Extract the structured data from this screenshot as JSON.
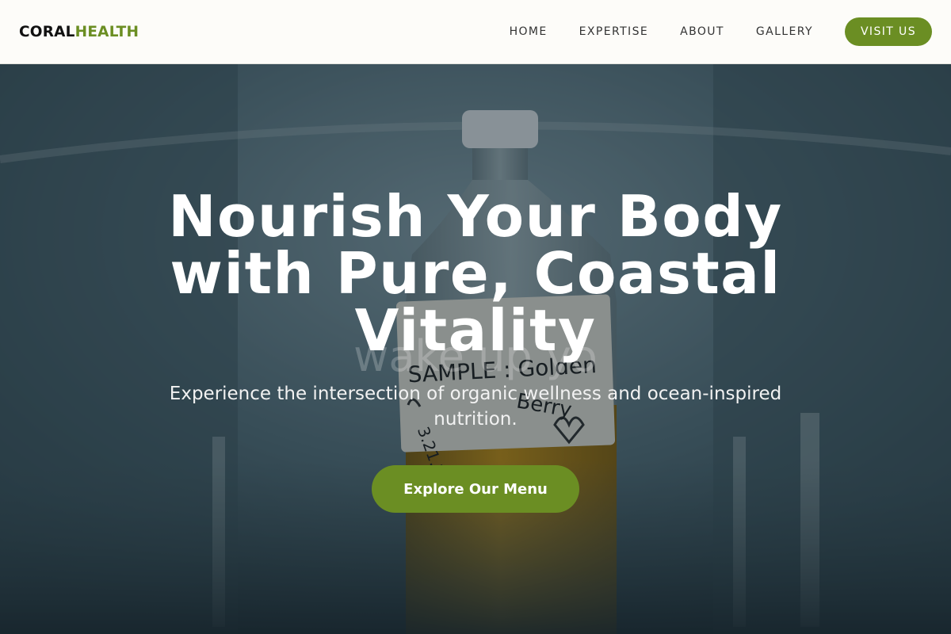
{
  "brand": {
    "part1": "CORAL",
    "part2": "HEALTH"
  },
  "nav": {
    "items": [
      {
        "label": "HOME"
      },
      {
        "label": "EXPERTISE"
      },
      {
        "label": "ABOUT"
      },
      {
        "label": "GALLERY"
      }
    ],
    "cta_label": "VISIT US"
  },
  "hero": {
    "title": "Nourish Your Body with Pure, Coastal Vitality",
    "subtitle": "Experience the intersection of organic wellness and ocean-inspired nutrition.",
    "cta_label": "Explore Our Menu",
    "image_label_lines": [
      "SAMPLE : Golden",
      "Berry",
      "3.21.21"
    ],
    "watermark": "wake up yo"
  },
  "colors": {
    "accent": "#6b8e23",
    "header_bg": "#fdfcf9",
    "overlay": "#14232d"
  }
}
